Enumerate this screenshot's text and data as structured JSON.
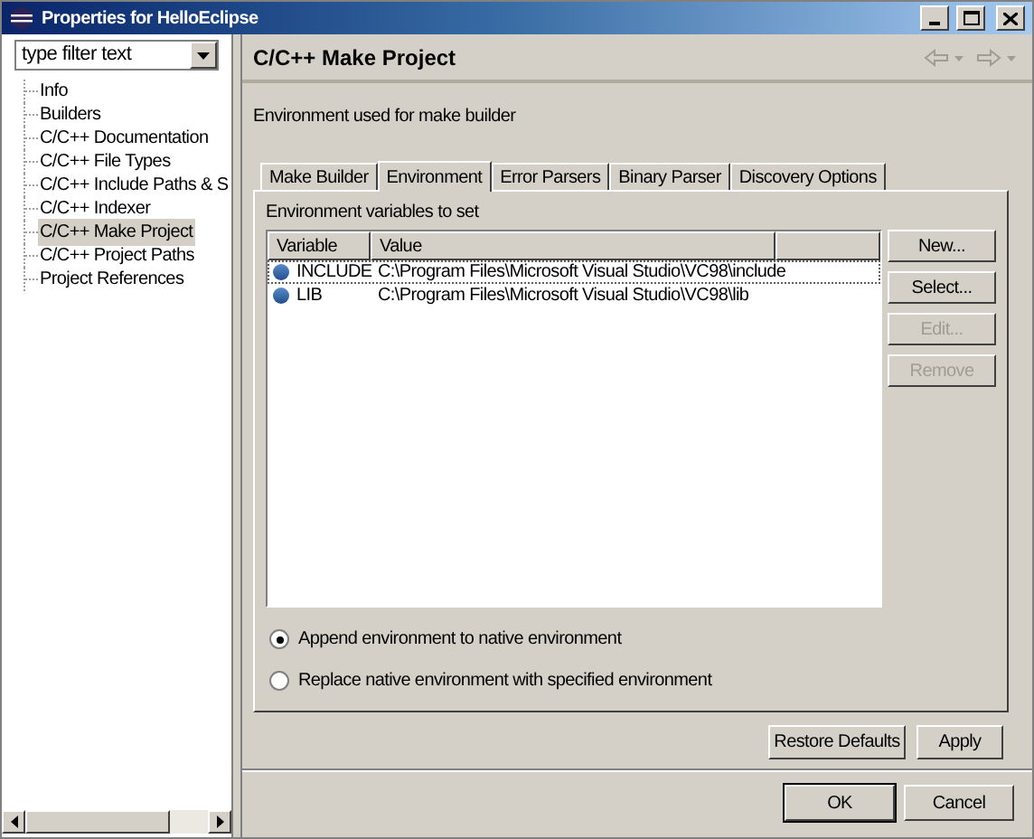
{
  "window": {
    "title": "Properties for HelloEclipse"
  },
  "filter": {
    "placeholder": "type filter text"
  },
  "tree": [
    {
      "label": "Info",
      "selected": false
    },
    {
      "label": "Builders",
      "selected": false
    },
    {
      "label": "C/C++ Documentation",
      "selected": false
    },
    {
      "label": "C/C++ File Types",
      "selected": false
    },
    {
      "label": "C/C++ Include Paths & S",
      "selected": false
    },
    {
      "label": "C/C++ Indexer",
      "selected": false
    },
    {
      "label": "C/C++ Make Project",
      "selected": true
    },
    {
      "label": "C/C++ Project Paths",
      "selected": false
    },
    {
      "label": "Project References",
      "selected": false
    }
  ],
  "page": {
    "title": "C/C++ Make Project",
    "description": "Environment used for make builder"
  },
  "tabs": [
    {
      "label": "Make Builder",
      "selected": false
    },
    {
      "label": "Environment",
      "selected": true
    },
    {
      "label": "Error Parsers",
      "selected": false
    },
    {
      "label": "Binary Parser",
      "selected": false
    },
    {
      "label": "Discovery Options",
      "selected": false
    }
  ],
  "environment": {
    "caption": "Environment variables to set",
    "columns": [
      "Variable",
      "Value"
    ],
    "rows": [
      {
        "variable": "INCLUDE",
        "value": "C:\\Program Files\\Microsoft Visual Studio\\VC98\\include",
        "selected": true
      },
      {
        "variable": "LIB",
        "value": "C:\\Program Files\\Microsoft Visual Studio\\VC98\\lib",
        "selected": false
      }
    ],
    "buttons": [
      {
        "label": "New...",
        "disabled": false
      },
      {
        "label": "Select...",
        "disabled": false
      },
      {
        "label": "Edit...",
        "disabled": true
      },
      {
        "label": "Remove",
        "disabled": true
      }
    ],
    "options": [
      {
        "label": "Append environment to native environment",
        "selected": true
      },
      {
        "label": "Replace native environment with specified environment",
        "selected": false
      }
    ]
  },
  "page_buttons": [
    "Restore Defaults",
    "Apply"
  ],
  "dialog_buttons": [
    {
      "label": "OK",
      "default": true
    },
    {
      "label": "Cancel",
      "default": false
    }
  ]
}
